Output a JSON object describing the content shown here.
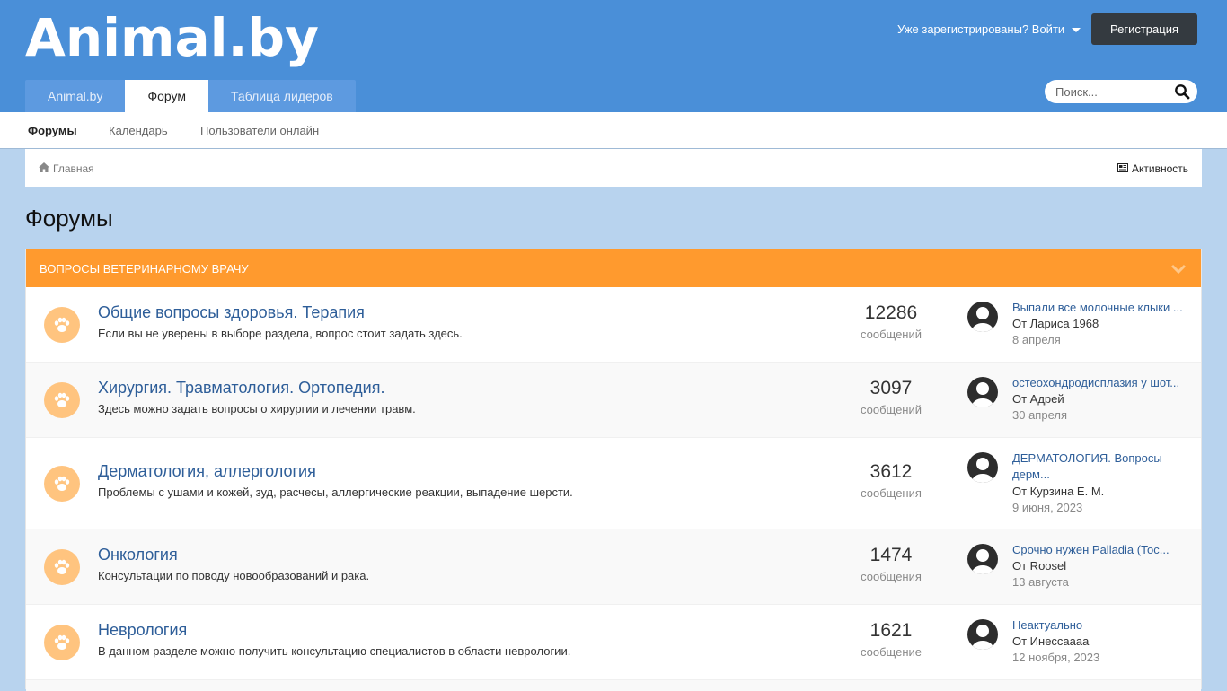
{
  "header": {
    "logo": "Animal.by",
    "login_text": "Уже зарегистрированы? Войти",
    "register_label": "Регистрация",
    "tabs": [
      {
        "label": "Animal.by"
      },
      {
        "label": "Форум"
      },
      {
        "label": "Таблица лидеров"
      }
    ],
    "active_tab": "Форум",
    "search_placeholder": "Поиск..."
  },
  "subnav": {
    "items": [
      {
        "label": "Форумы"
      },
      {
        "label": "Календарь"
      },
      {
        "label": "Пользователи онлайн"
      }
    ]
  },
  "breadcrumb": {
    "home_label": "Главная",
    "activity_label": "Активность"
  },
  "page_title": "Форумы",
  "section": {
    "title": "ВОПРОСЫ ВЕТЕРИНАРНОМУ ВРАЧУ",
    "forums": [
      {
        "title": "Общие вопросы здоровья. Терапия",
        "description": "Если вы не уверены в выборе раздела, вопрос стоит задать здесь.",
        "count": "12286",
        "count_label": "сообщений",
        "last_title": "Выпали все молочные клыки ...",
        "last_by": "От Лариса 1968",
        "last_date": "8 апреля"
      },
      {
        "title": "Хирургия. Травматология. Ортопедия.",
        "description": "Здесь можно задать вопросы о хирургии и лечении травм.",
        "count": "3097",
        "count_label": "сообщений",
        "last_title": "остеохондродисплазия у шот...",
        "last_by": "От Адрей",
        "last_date": "30 апреля"
      },
      {
        "title": "Дерматология, аллергология",
        "description": "Проблемы с ушами и кожей, зуд, расчесы, аллергические реакции, выпадение шерсти.",
        "count": "3612",
        "count_label": "сообщения",
        "last_title": "ДЕРМАТОЛОГИЯ. Вопросы дерм...",
        "last_by": "От Курзина Е. М.",
        "last_date": "9 июня, 2023"
      },
      {
        "title": "Онкология",
        "description": "Консультации по поводу новообразований и рака.",
        "count": "1474",
        "count_label": "сообщения",
        "last_title": "Срочно нужен Palladia (Тос...",
        "last_by": "От Roosel",
        "last_date": "13 августа"
      },
      {
        "title": "Неврология",
        "description": "В данном разделе можно получить консультацию специалистов в области неврологии.",
        "count": "1621",
        "count_label": "сообщение",
        "last_title": "Неактуально",
        "last_by": "От Инессаааа",
        "last_date": "12 ноября, 2023"
      }
    ]
  },
  "colors": {
    "header_bg": "#4a8fd8",
    "section_header": "#ff9a2e",
    "link": "#2e5e99",
    "page_bg": "#b8d3ee"
  }
}
